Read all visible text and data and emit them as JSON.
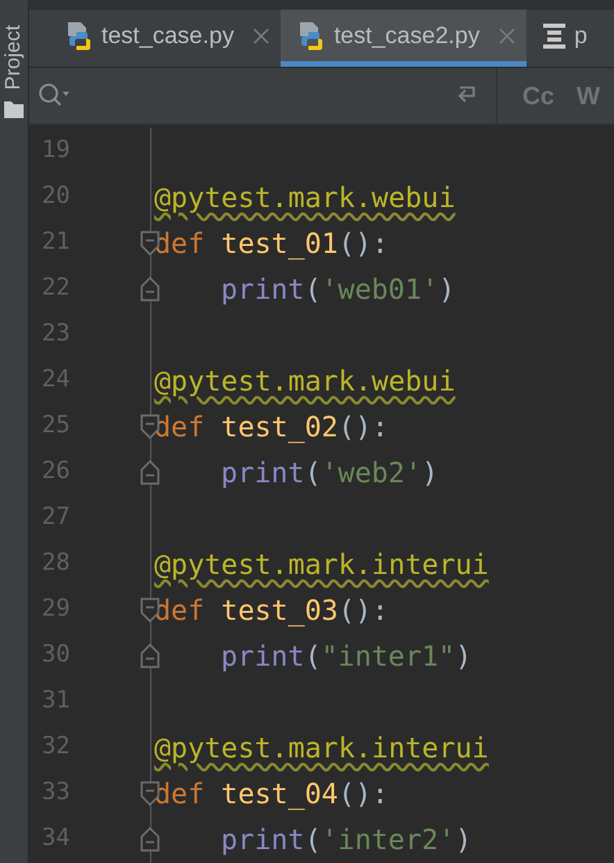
{
  "side_panel": {
    "label": "Project"
  },
  "tabs": [
    {
      "label": "test_case.py",
      "selected": false,
      "closable": true,
      "kind": "python"
    },
    {
      "label": "test_case2.py",
      "selected": true,
      "closable": true,
      "kind": "python"
    },
    {
      "label": "p",
      "selected": false,
      "closable": false,
      "kind": "structure"
    }
  ],
  "search_bar": {
    "toggles": [
      "Cc",
      "W"
    ]
  },
  "editor": {
    "lines": [
      {
        "number": "19",
        "kind": "plain"
      },
      {
        "number": "20",
        "kind": "plain",
        "tokens": [
          {
            "kind": "decorator",
            "text": "@pytest.mark.webui"
          }
        ]
      },
      {
        "number": "21",
        "kind": "block_start",
        "tokens": [
          {
            "kind": "keyword",
            "text": "def "
          },
          {
            "kind": "function",
            "text": "test_01"
          },
          {
            "kind": "paren",
            "text": "()"
          },
          {
            "kind": "plain",
            "text": ":"
          }
        ]
      },
      {
        "number": "22",
        "kind": "block_end",
        "indented": true,
        "tokens": [
          {
            "kind": "builtin",
            "text": "print"
          },
          {
            "kind": "paren",
            "text": "("
          },
          {
            "kind": "string",
            "text": "'web01'"
          },
          {
            "kind": "paren",
            "text": ")"
          }
        ]
      },
      {
        "number": "23",
        "kind": "plain"
      },
      {
        "number": "24",
        "kind": "plain",
        "tokens": [
          {
            "kind": "decorator",
            "text": "@pytest.mark.webui"
          }
        ]
      },
      {
        "number": "25",
        "kind": "block_start",
        "tokens": [
          {
            "kind": "keyword",
            "text": "def "
          },
          {
            "kind": "function",
            "text": "test_02"
          },
          {
            "kind": "paren",
            "text": "()"
          },
          {
            "kind": "plain",
            "text": ":"
          }
        ]
      },
      {
        "number": "26",
        "kind": "block_end",
        "indented": true,
        "tokens": [
          {
            "kind": "builtin",
            "text": "print"
          },
          {
            "kind": "paren",
            "text": "("
          },
          {
            "kind": "string",
            "text": "'web2'"
          },
          {
            "kind": "paren",
            "text": ")"
          }
        ]
      },
      {
        "number": "27",
        "kind": "plain"
      },
      {
        "number": "28",
        "kind": "plain",
        "tokens": [
          {
            "kind": "decorator",
            "text": "@pytest.mark.interui"
          }
        ]
      },
      {
        "number": "29",
        "kind": "block_start",
        "tokens": [
          {
            "kind": "keyword",
            "text": "def "
          },
          {
            "kind": "function",
            "text": "test_03"
          },
          {
            "kind": "paren",
            "text": "()"
          },
          {
            "kind": "plain",
            "text": ":"
          }
        ]
      },
      {
        "number": "30",
        "kind": "block_end",
        "indented": true,
        "tokens": [
          {
            "kind": "builtin",
            "text": "print"
          },
          {
            "kind": "paren",
            "text": "("
          },
          {
            "kind": "string",
            "text": "\"inter1\""
          },
          {
            "kind": "paren",
            "text": ")"
          }
        ]
      },
      {
        "number": "31",
        "kind": "plain"
      },
      {
        "number": "32",
        "kind": "plain",
        "tokens": [
          {
            "kind": "decorator",
            "text": "@pytest.mark.interui"
          }
        ]
      },
      {
        "number": "33",
        "kind": "block_start",
        "tokens": [
          {
            "kind": "keyword",
            "text": "def "
          },
          {
            "kind": "function",
            "text": "test_04"
          },
          {
            "kind": "paren",
            "text": "()"
          },
          {
            "kind": "plain",
            "text": ":"
          }
        ]
      },
      {
        "number": "34",
        "kind": "block_end",
        "indented": true,
        "tokens": [
          {
            "kind": "builtin",
            "text": "print"
          },
          {
            "kind": "paren",
            "text": "("
          },
          {
            "kind": "string",
            "text": "'inter2'"
          },
          {
            "kind": "paren",
            "text": ")"
          }
        ]
      }
    ]
  }
}
